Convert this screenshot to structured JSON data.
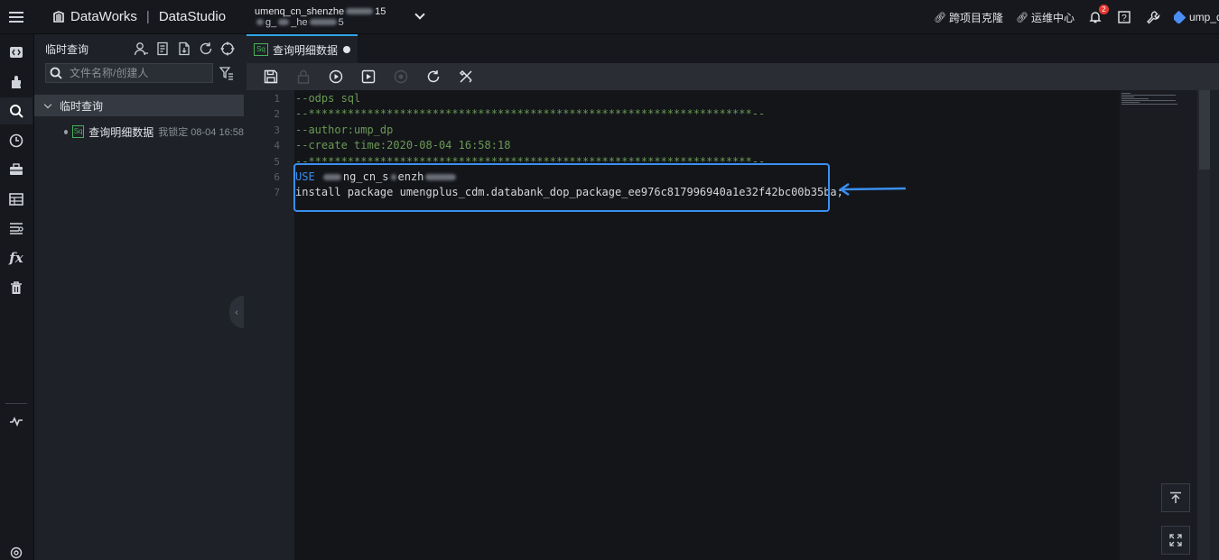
{
  "header": {
    "brand": "DataWorks",
    "product": "DataStudio",
    "project_line1": "umeng_cn_shenzhen_15",
    "project_line1_pre": "umenq_cn_shenzhe",
    "project_line1_post": "15",
    "project_line2_pre": "g_",
    "project_line2_mid": "_he",
    "project_line2_post": "5",
    "links": [
      {
        "label": "跨项目克隆",
        "icon": "link-icon"
      },
      {
        "label": "运维中心",
        "icon": "link-icon"
      }
    ],
    "notification_count": "2",
    "user": "ump_d"
  },
  "rail": {
    "items": [
      "code-icon",
      "component-icon",
      "search-icon",
      "history-icon",
      "toolbox-icon",
      "table-icon",
      "list-icon",
      "function-icon",
      "trash-icon",
      "monitor-icon",
      "settings-icon"
    ],
    "active": "search-icon",
    "function_glyph": "fx"
  },
  "explorer": {
    "title": "临时查询",
    "search_placeholder": "文件名称/创建人",
    "tree_root": "临时查询",
    "files": [
      {
        "icon_text": "Sq",
        "name": "查询明细数据",
        "meta": "我锁定 08-04 16:58"
      }
    ]
  },
  "editor": {
    "tab": {
      "icon_text": "Sq",
      "title": "查询明细数据"
    },
    "line_numbers": [
      "1",
      "2",
      "3",
      "4",
      "5",
      "6",
      "7"
    ],
    "lines": [
      "--odps sql",
      "--********************************************************************--",
      "--author:ump_dp",
      "--create time:2020-08-04 16:58:18",
      "--********************************************************************--"
    ],
    "use_keyword": "USE",
    "use_target_pre": "ng_cn_s",
    "use_target_post": "enzh",
    "install_line": "install package umengplus_cdm.databank_dop_package_ee976c817996940a1e32f42bc00b35ba;"
  },
  "colors": {
    "accent": "#2fa4e7",
    "highlight": "#3b8ff0",
    "comment": "#6a9955",
    "keyword": "#3b8eea",
    "badge": "#e5382f",
    "sql_icon": "#48b15a"
  }
}
